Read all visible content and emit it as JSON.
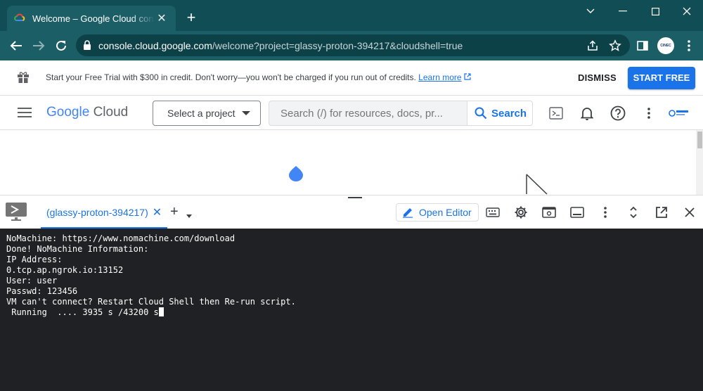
{
  "browser": {
    "tab_title": "Welcome – Google Cloud console",
    "url_host": "console.cloud.google.com",
    "url_path": "/welcome?project=glassy-proton-394217&cloudshell=true",
    "avatar_text": "CINEC"
  },
  "banner": {
    "text": "Start your Free Trial with $300 in credit. Don't worry—you won't be charged if you run out of credits.",
    "learn_more": "Learn more",
    "dismiss": "DISMISS",
    "start_free": "START FREE"
  },
  "header": {
    "logo_google": "Google",
    "logo_cloud": "Cloud",
    "project_selector": "Select a project",
    "search_placeholder": "Search (/) for resources, docs, pr...",
    "search_button": "Search"
  },
  "cloudshell": {
    "tab_label": "(glassy-proton-394217)",
    "open_editor": "Open Editor",
    "terminal_lines": [
      "NoMachine: https://www.nomachine.com/download",
      "Done! NoMachine Information:",
      "IP Address:",
      "0.tcp.ap.ngrok.io:13152",
      "User: user",
      "Passwd: 123456",
      "VM can't connect? Restart Cloud Shell then Re-run script.",
      " Running  .... 3935 s /43200 s"
    ]
  },
  "colors": {
    "chrome_frame": "#114d55",
    "chrome_toolbar": "#1c5e66",
    "accent_blue": "#1a73e8",
    "terminal_bg": "#202124"
  }
}
